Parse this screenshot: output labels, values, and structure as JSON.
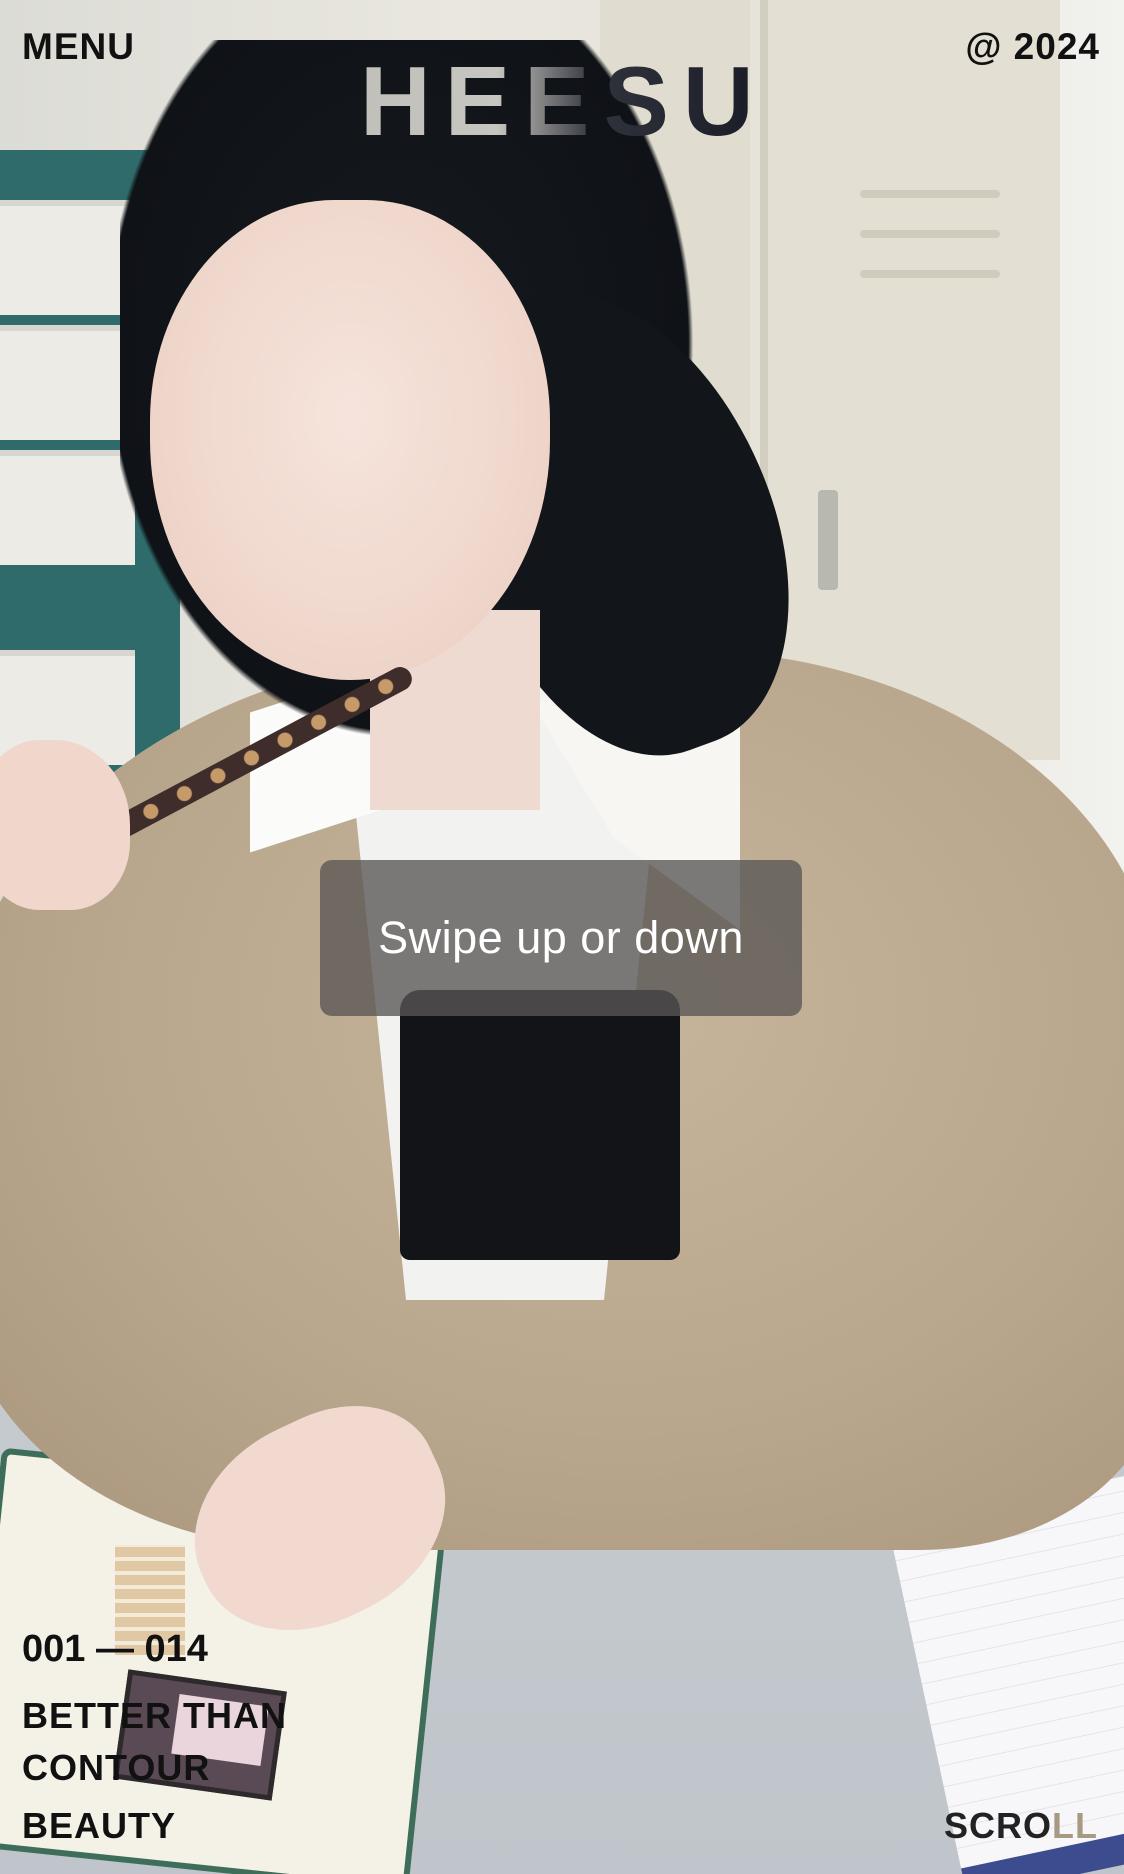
{
  "header": {
    "menu_label": "MENU",
    "brand": "HEESU",
    "year_label": "@ 2024"
  },
  "overlay": {
    "gesture_hint": "Swipe up or down"
  },
  "feature": {
    "counter": "001 — 014",
    "title": "BETTER THAN\nCONTOUR",
    "category": "BEAUTY"
  },
  "footer": {
    "scroll_label": "SCROLL"
  },
  "hero_image": {
    "subject": "model in beige blazer holding a pencil at an office desk"
  },
  "colors": {
    "text": "#111111",
    "logo_dark": "#1b1d28",
    "toast_bg": "rgba(88,86,84,0.78)",
    "toast_text": "#ffffff",
    "blazer": "#b9a78d"
  }
}
